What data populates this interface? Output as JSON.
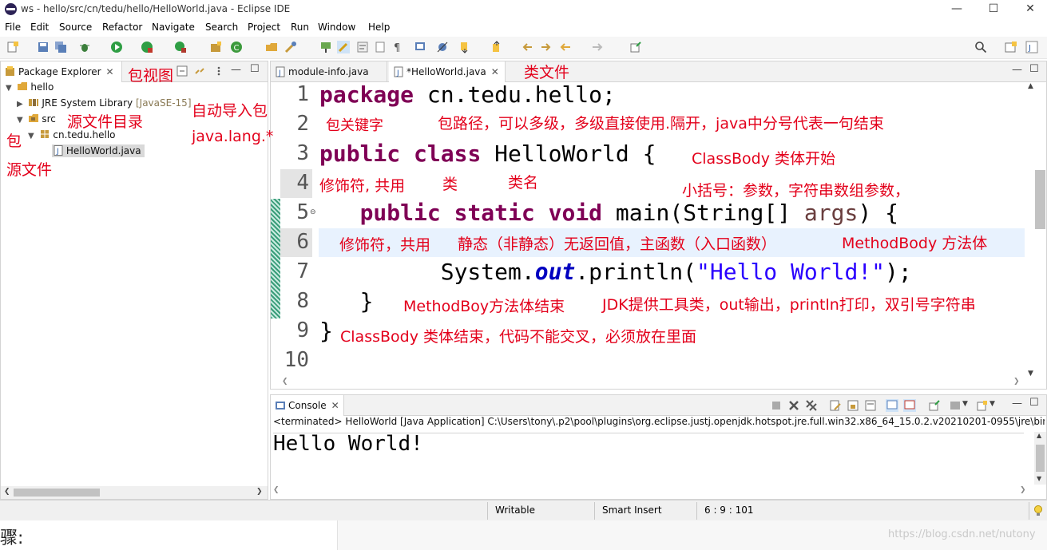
{
  "window": {
    "title": "ws - hello/src/cn/tedu/hello/HelloWorld.java - Eclipse IDE",
    "minimize": "—",
    "maximize": "☐",
    "close": "✕"
  },
  "menu": [
    "File",
    "Edit",
    "Source",
    "Refactor",
    "Navigate",
    "Search",
    "Project",
    "Run",
    "Window",
    "Help"
  ],
  "package_explorer": {
    "tab_label": "Package Explorer",
    "close": "✕",
    "tree": {
      "project": "hello",
      "jre": "JRE System Library",
      "jre_version": "[JavaSE-15]",
      "src": "src",
      "package": "cn.tedu.hello",
      "file": "HelloWorld.java"
    }
  },
  "editor": {
    "tabs": [
      {
        "label": "module-info.java"
      },
      {
        "label": "*HelloWorld.java",
        "close": "✕"
      }
    ],
    "line_numbers": [
      "1",
      "2",
      "3",
      "4",
      "5",
      "6",
      "7",
      "8",
      "9",
      "10"
    ],
    "code": {
      "l1_kw": "package",
      "l1_rest": " cn.tedu.hello;",
      "l3_kw1": "public",
      "l3_kw2": "class",
      "l3_rest": " HelloWorld {",
      "l5_indent": "   ",
      "l5_kw1": "public",
      "l5_kw2": "static",
      "l5_kw3": "void",
      "l5_main": " main(String[] ",
      "l5_param": "args",
      "l5_end": ") {",
      "l7_indent": "         System.",
      "l7_field": "out",
      "l7_mid": ".println(",
      "l7_str": "\"Hello World!\"",
      "l7_end": ");",
      "l8": "   }",
      "l9": "}"
    }
  },
  "annotations": {
    "pkg_view": "包视图",
    "class_file": "类文件",
    "src_dir": "源文件目录",
    "auto_import": "自动导入包",
    "java_lang": "java.lang.*",
    "pkg": "包",
    "src_file": "源文件",
    "pkg_keyword": "包关键字",
    "pkg_path": "包路径，可以多级，多级直接使用.隔开，java中分号代表一句结束",
    "class_body_start": "ClassBody 类体开始",
    "modifier_public": "修饰符, 共用",
    "class_word": "类",
    "class_name": "类名",
    "paren_param": "小括号：参数，字符串数组参数，",
    "modifier_public2": "修饰符，共用",
    "static_desc": "静态（非静态）无返回值，主函数（入口函数）",
    "method_body": "MethodBody 方法体",
    "method_body_end": "MethodBoy方法体结束",
    "jdk_tool": "JDK提供工具类，out输出，println打印，双引号字符串",
    "class_body_end": "ClassBody 类体结束，代码不能交叉，必须放在里面"
  },
  "console": {
    "tab_label": "Console",
    "close": "✕",
    "terminated": "<terminated> HelloWorld [Java Application] C:\\Users\\tony\\.p2\\pool\\plugins\\org.eclipse.justj.openjdk.hotspot.jre.full.win32.x86_64_15.0.2.v20210201-0955\\jre\\bin\\javaw.",
    "output": "Hello World!"
  },
  "status": {
    "writable": "Writable",
    "insert_mode": "Smart Insert",
    "position": "6 : 9 : 101"
  },
  "footer": {
    "fragment": "骤:",
    "watermark": "https://blog.csdn.net/nutony"
  },
  "colors": {
    "keyword": "#7f0055",
    "string": "#2a00ff",
    "field": "#0000c0",
    "annotation": "#e3001b",
    "current_line": "#e8f2fe"
  }
}
